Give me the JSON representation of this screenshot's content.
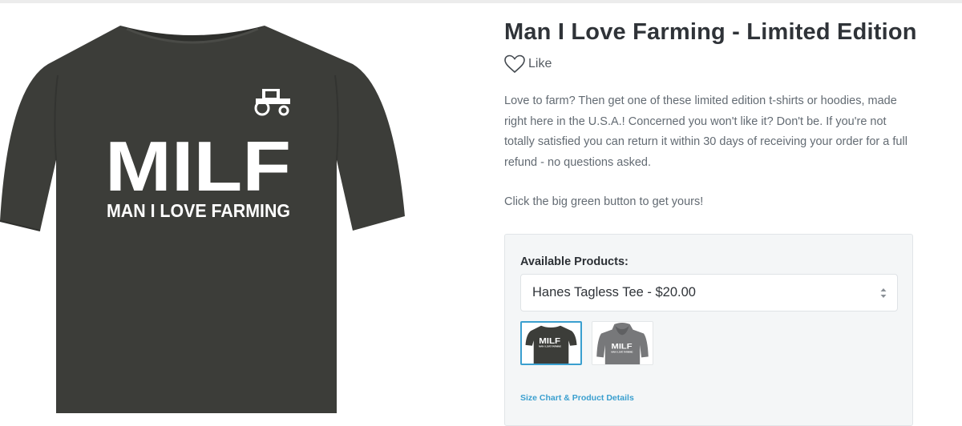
{
  "product": {
    "title": "Man I Love Farming - Limited Edition",
    "like_label": "Like",
    "description": "Love to farm? Then get one of these limited edition t-shirts or hoodies, made right here in the U.S.A.! Concerned you won't like it? Don't be. If you're not totally satisfied you can return it within 30 days of receiving your order for a full refund - no questions asked.",
    "cta_text": "Click the big green button to get yours!"
  },
  "hero_image": {
    "main_text": "MILF",
    "sub_text": "MAN I LOVE FARMING",
    "shirt_color": "#3c3d39",
    "icon": "tractor-icon"
  },
  "products_panel": {
    "label": "Available Products:",
    "selected_value": "Hanes Tagless Tee - $20.00",
    "thumbnails": [
      {
        "name": "tee-thumbnail",
        "main_text": "MILF",
        "sub_text": "MAN I LOVE FARMING",
        "selected": true
      },
      {
        "name": "hoodie-thumbnail",
        "main_text": "MILF",
        "sub_text": "MAN I LOVE FARMING",
        "selected": false
      }
    ],
    "size_chart_link": "Size Chart & Product Details"
  },
  "colors": {
    "title": "#2f3338",
    "body_text": "#636b73",
    "accent": "#3a9fcf",
    "panel_bg": "#f4f6f7"
  }
}
